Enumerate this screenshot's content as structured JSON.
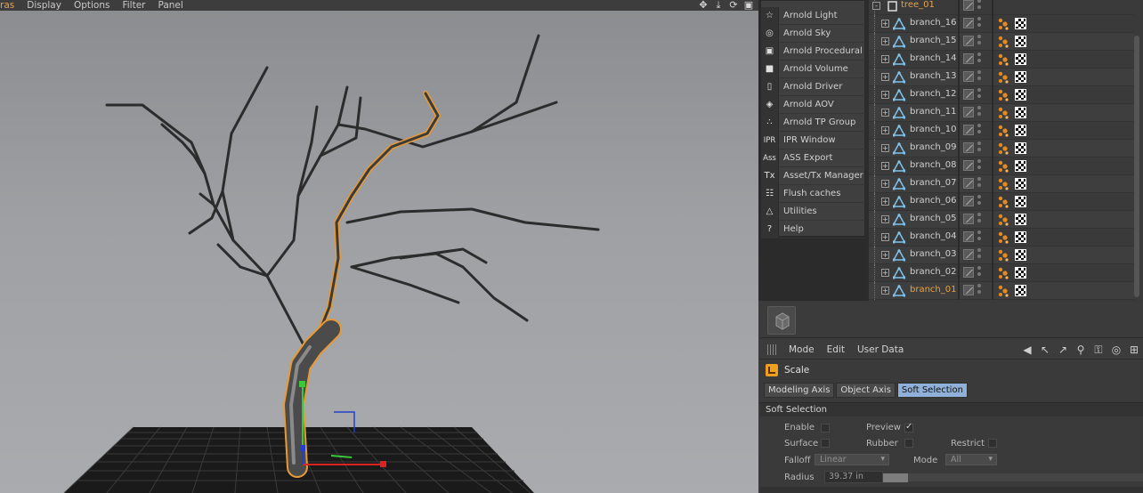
{
  "viewport": {
    "menu": [
      "ras",
      "Display",
      "Options",
      "Filter",
      "Panel"
    ],
    "nav_icons": [
      "move-view-icon",
      "dolly-view-icon",
      "rotate-view-icon",
      "maximize-view-icon"
    ]
  },
  "arnold_menu": {
    "items": [
      {
        "label": "Arnold Light",
        "icon": "bulb-icon",
        "glyph": "☆"
      },
      {
        "label": "Arnold Sky",
        "icon": "sky-globe-icon",
        "glyph": "◎"
      },
      {
        "label": "Arnold Procedural",
        "icon": "procedural-cube-icon",
        "glyph": "▣"
      },
      {
        "label": "Arnold Volume",
        "icon": "volume-cube-icon",
        "glyph": "■"
      },
      {
        "label": "Arnold Driver",
        "icon": "driver-doc-icon",
        "glyph": "▯"
      },
      {
        "label": "Arnold AOV",
        "icon": "aov-layers-icon",
        "glyph": "◈"
      },
      {
        "label": "Arnold TP Group",
        "icon": "tp-group-dots-icon",
        "glyph": "∴"
      },
      {
        "label": "IPR Window",
        "icon": "ipr-icon",
        "glyph": "IPR"
      },
      {
        "label": "ASS Export",
        "icon": "ass-export-icon",
        "glyph": "Ass"
      },
      {
        "label": "Asset/Tx Manager",
        "icon": "tx-manager-icon",
        "glyph": "Tx"
      },
      {
        "label": "Flush caches",
        "icon": "trash-icon",
        "glyph": "☷"
      },
      {
        "label": "Utilities",
        "icon": "utilities-flask-icon",
        "glyph": "△"
      },
      {
        "label": "Help",
        "icon": "help-icon",
        "glyph": "?"
      }
    ]
  },
  "object_manager": {
    "parent": "tree_01",
    "objects": [
      {
        "name": "branch_16",
        "selected": false
      },
      {
        "name": "branch_15",
        "selected": false
      },
      {
        "name": "branch_14",
        "selected": false
      },
      {
        "name": "branch_13",
        "selected": false
      },
      {
        "name": "branch_12",
        "selected": false
      },
      {
        "name": "branch_11",
        "selected": false
      },
      {
        "name": "branch_10",
        "selected": false
      },
      {
        "name": "branch_09",
        "selected": false
      },
      {
        "name": "branch_08",
        "selected": false
      },
      {
        "name": "branch_07",
        "selected": false
      },
      {
        "name": "branch_06",
        "selected": false
      },
      {
        "name": "branch_05",
        "selected": false
      },
      {
        "name": "branch_04",
        "selected": false
      },
      {
        "name": "branch_03",
        "selected": false
      },
      {
        "name": "branch_02",
        "selected": false
      },
      {
        "name": "branch_01",
        "selected": true
      }
    ]
  },
  "attributes": {
    "menu": [
      "Mode",
      "Edit",
      "User Data"
    ],
    "tool_name": "Scale",
    "tabs": [
      "Modeling Axis",
      "Object Axis",
      "Soft Selection"
    ],
    "active_tab": "Soft Selection",
    "section_title": "Soft Selection",
    "fields": {
      "enable": {
        "label": "Enable",
        "checked": false
      },
      "preview": {
        "label": "Preview",
        "checked": true
      },
      "surface": {
        "label": "Surface",
        "checked": false
      },
      "rubber": {
        "label": "Rubber",
        "checked": false
      },
      "restrict": {
        "label": "Restrict",
        "checked": false
      },
      "falloff": {
        "label": "Falloff",
        "value": "Linear"
      },
      "mode": {
        "label": "Mode",
        "value": "All"
      },
      "radius": {
        "label": "Radius",
        "value": "39.37 in"
      }
    }
  },
  "colors": {
    "selection_orange": "#f0a030",
    "active_tab": "#8fb0d8",
    "viewport_bg": "#9ea0a3"
  }
}
